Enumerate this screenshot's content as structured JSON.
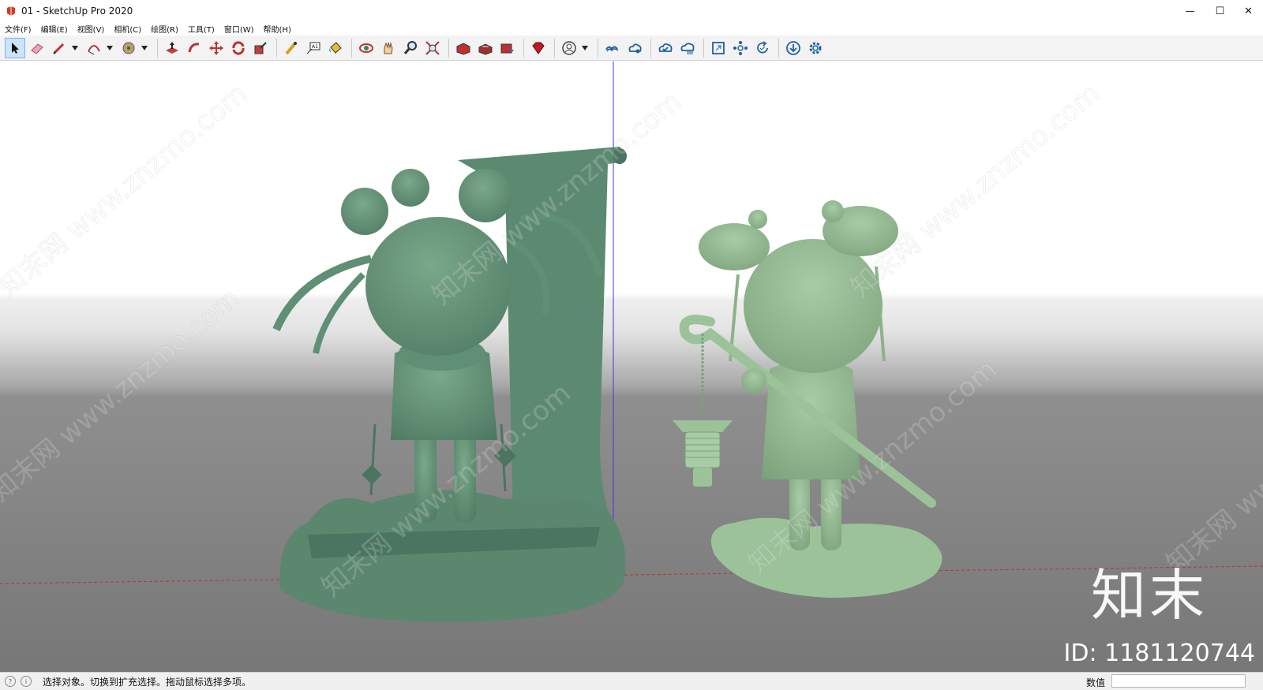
{
  "window": {
    "title": "01 - SketchUp Pro 2020",
    "minimize_glyph": "—",
    "maximize_glyph": "☐",
    "close_glyph": "✕"
  },
  "menu": [
    "文件(F)",
    "编辑(E)",
    "视图(V)",
    "相机(C)",
    "绘图(R)",
    "工具(T)",
    "窗口(W)",
    "帮助(H)"
  ],
  "toolbar": {
    "icons": [
      "select-icon",
      "eraser-icon",
      "pencil-icon",
      "arc-icon",
      "shape-icon",
      "push-pull-icon",
      "follow-me-icon",
      "move-icon",
      "rotate-icon",
      "scale-icon",
      "tape-measure-icon",
      "text-icon",
      "paint-bucket-icon",
      "orbit-icon",
      "pan-icon",
      "zoom-icon",
      "zoom-extents-icon",
      "warehouse-icon",
      "share-model-icon",
      "extension-warehouse-icon",
      "ruby-icon",
      "account-icon",
      "trimble-connect-icon",
      "trimble-share-icon",
      "sync-icon",
      "cloud-list-icon",
      "expand-icon",
      "components-icon",
      "refresh-icon",
      "download-icon",
      "settings-icon"
    ]
  },
  "viewport": {
    "watermark": "知末网 www.znzmo.com",
    "logo": "知末",
    "id_label": "ID: 1181120744"
  },
  "status": {
    "message": "选择对象。切换到扩充选择。拖动鼠标选择多项。",
    "measure_label": "数值",
    "measure_value": ""
  },
  "colors": {
    "figure_left": "#5f8f74",
    "figure_right": "#8fb890",
    "ground": "#767676",
    "sky": "#ffffff",
    "accent_select": "#cde3f8"
  }
}
